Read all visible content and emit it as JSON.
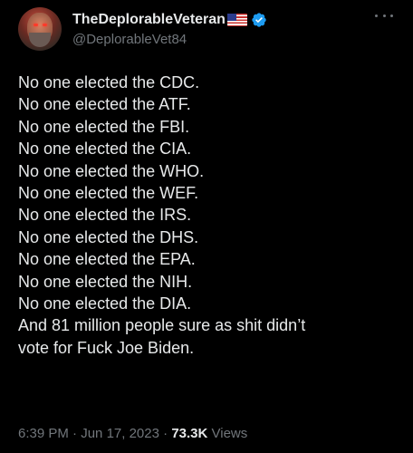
{
  "author": {
    "display_name": "TheDeplorableVeteran",
    "handle": "@DeplorableVet84",
    "flag_icon": "us-flag-icon",
    "verified_icon": "verified-badge-icon",
    "verified_color": "#1d9bf0"
  },
  "tweet": {
    "lines": [
      "No one elected the CDC.",
      "No one elected the ATF.",
      "No one elected the FBI.",
      "No one elected the CIA.",
      "No one elected the WHO.",
      "No one elected the WEF.",
      "No one elected the IRS.",
      "No one elected the DHS.",
      "No one elected the EPA.",
      "No one elected the NIH.",
      "No one elected the DIA.",
      "And 81 million people sure as shit didn’t",
      "vote for Fuck Joe Biden."
    ]
  },
  "meta": {
    "time": "6:39 PM",
    "separator": " · ",
    "date": "Jun 17, 2023",
    "views_count": "73.3K",
    "views_label": " Views"
  },
  "colors": {
    "background": "#000000",
    "text": "#e7e9ea",
    "secondary": "#71767b"
  }
}
